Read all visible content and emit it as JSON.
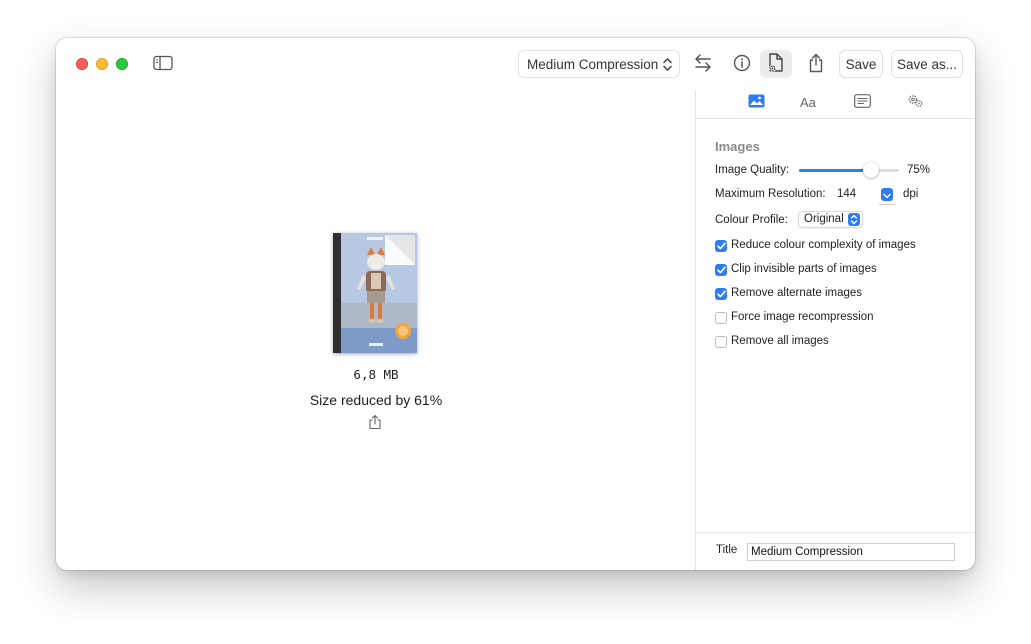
{
  "toolbar": {
    "preset": "Medium Compression",
    "save_label": "Save",
    "save_as_label": "Save as..."
  },
  "document": {
    "size": "6,8 MB",
    "reduced": "Size reduced by 61%"
  },
  "panel": {
    "tabs": [
      "image-icon",
      "font-icon",
      "text-icon",
      "gears-icon"
    ],
    "active_tab": 0,
    "section_title": "Images",
    "image_quality_label": "Image Quality:",
    "image_quality_value": "75%",
    "image_quality_fraction": 0.72,
    "max_resolution_label": "Maximum Resolution:",
    "max_resolution_value": "144",
    "max_resolution_unit": "dpi",
    "colour_profile_label": "Colour Profile:",
    "colour_profile_value": "Original",
    "options": [
      {
        "label": "Reduce colour complexity of images",
        "checked": true
      },
      {
        "label": "Clip invisible parts of images",
        "checked": true
      },
      {
        "label": "Remove alternate images",
        "checked": true
      },
      {
        "label": "Force image recompression",
        "checked": false
      },
      {
        "label": "Remove all images",
        "checked": false
      }
    ],
    "title_label": "Title",
    "title_value": "Medium Compression"
  },
  "colors": {
    "accent": "#2e7cf6",
    "close": "#fe5f57",
    "minimize": "#febc2e",
    "zoom": "#28c840"
  }
}
